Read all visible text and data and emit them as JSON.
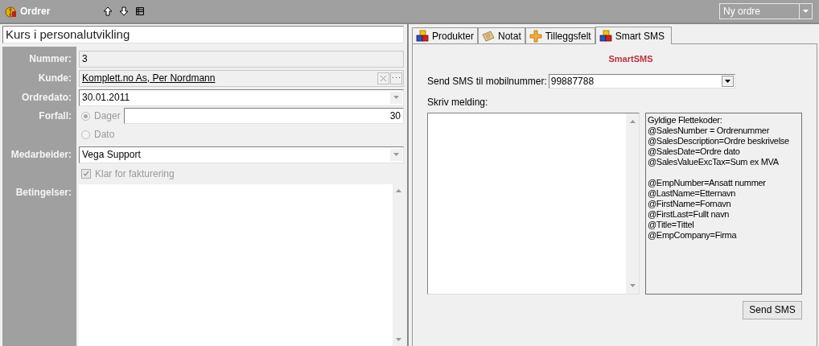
{
  "toolbar": {
    "title": "Ordrer",
    "dropdown": "Ny ordre"
  },
  "order_title": "Kurs i personalutvikling",
  "form": {
    "number": {
      "label": "Nummer:",
      "value": "3"
    },
    "customer": {
      "label": "Kunde:",
      "value": "Komplett.no As, Per Nordmann"
    },
    "order_date": {
      "label": "Ordredato:",
      "value": "30.01.2011"
    },
    "due": {
      "label": "Forfall:",
      "disabled": true,
      "options": [
        {
          "label": "Dager",
          "selected": true,
          "value": "30"
        },
        {
          "label": "Dato",
          "selected": false
        }
      ]
    },
    "employee": {
      "label": "Medarbeider:",
      "value": "Vega Support"
    },
    "ready": {
      "label": "Klar for fakturering",
      "checked": true,
      "disabled": true
    },
    "terms": {
      "label": "Betingelser:"
    }
  },
  "tabs": [
    {
      "label": "Produkter",
      "selected": false
    },
    {
      "label": "Notat",
      "selected": false
    },
    {
      "label": "Tilleggsfelt",
      "selected": false
    },
    {
      "label": "Smart SMS",
      "selected": true
    }
  ],
  "sms": {
    "heading": "SmartSMS",
    "phone_label": "Send SMS til mobilnummer:",
    "phone": "99887788",
    "message_label": "Skriv melding:",
    "merge_codes": [
      [
        "Gyldige Flettekoder:",
        "@SalesNumber = Ordrenummer",
        "@SalesDescription=Ordre beskrivelse",
        "@SalesDate=Ordre dato",
        "@SalesValueExcTax=Sum ex MVA"
      ],
      [
        "@EmpNumber=Ansatt nummer",
        "@LastName=Etternavn",
        "@FirstName=Fornavn",
        "@FirstLast=Fullt navn",
        "@Title=Tittel",
        "@EmpCompany=Firma"
      ]
    ],
    "send_button": "Send SMS"
  }
}
